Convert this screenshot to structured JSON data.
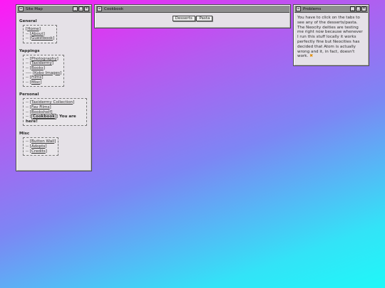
{
  "site_map": {
    "title": "Site Map",
    "general": {
      "heading": "General",
      "items": [
        {
          "prefix": "",
          "label": "Home",
          "current": false
        },
        {
          "prefix": "-- ",
          "label": "About",
          "current": false
        },
        {
          "prefix": "-- ",
          "label": "Guestbook",
          "current": false
        }
      ]
    },
    "yappings": {
      "heading": "Yappings",
      "items": [
        {
          "prefix": "-- ",
          "label": "Photography",
          "current": false
        },
        {
          "prefix": "-- ",
          "label": "Taxidermy",
          "current": false
        },
        {
          "prefix": "-- ",
          "label": "Books",
          "current": false
        },
        {
          "prefix": "---- ",
          "label": "Kobo Images",
          "current": false
        },
        {
          "prefix": "-- ",
          "label": "Films",
          "current": false
        },
        {
          "prefix": "-- ",
          "label": "Misc",
          "current": false
        }
      ]
    },
    "personal": {
      "heading": "Personal",
      "items": [
        {
          "prefix": "-- ",
          "label": "Taxidermy Collection",
          "current": false
        },
        {
          "prefix": "-- ",
          "label": "Fav Films",
          "current": false
        },
        {
          "prefix": "-- ",
          "label": "Bookshelf",
          "current": false
        },
        {
          "prefix": "-- ",
          "label": "Cookbook",
          "current": true,
          "suffix": " You are here!"
        }
      ]
    },
    "misc": {
      "heading": "Misc",
      "items": [
        {
          "prefix": "-- ",
          "label": "Button Wall",
          "current": false
        },
        {
          "prefix": "-- ",
          "label": "Adopts",
          "current": false
        },
        {
          "prefix": "-- ",
          "label": "Credits",
          "current": false
        }
      ]
    }
  },
  "cookbook": {
    "title": "Cookbook",
    "tabs": [
      "Desserts",
      "Pasta"
    ]
  },
  "problems": {
    "title": "Problems",
    "message": "You have to click on the tabs to see any of the desserts/pasta. The Neocity deities are testing me right now because whenever I run this stuff locally it works perfectly fine but Neocities has decided that Atom is actually wrong and it, in fact, doesn't work.",
    "emoji": "✖"
  },
  "window_buttons": {
    "minimize": "_",
    "maximize": "□",
    "close": "✕"
  },
  "colors": {
    "warning": "#e08a00",
    "titlebar": "#8e8e8e",
    "window": "#e5e1e7"
  }
}
